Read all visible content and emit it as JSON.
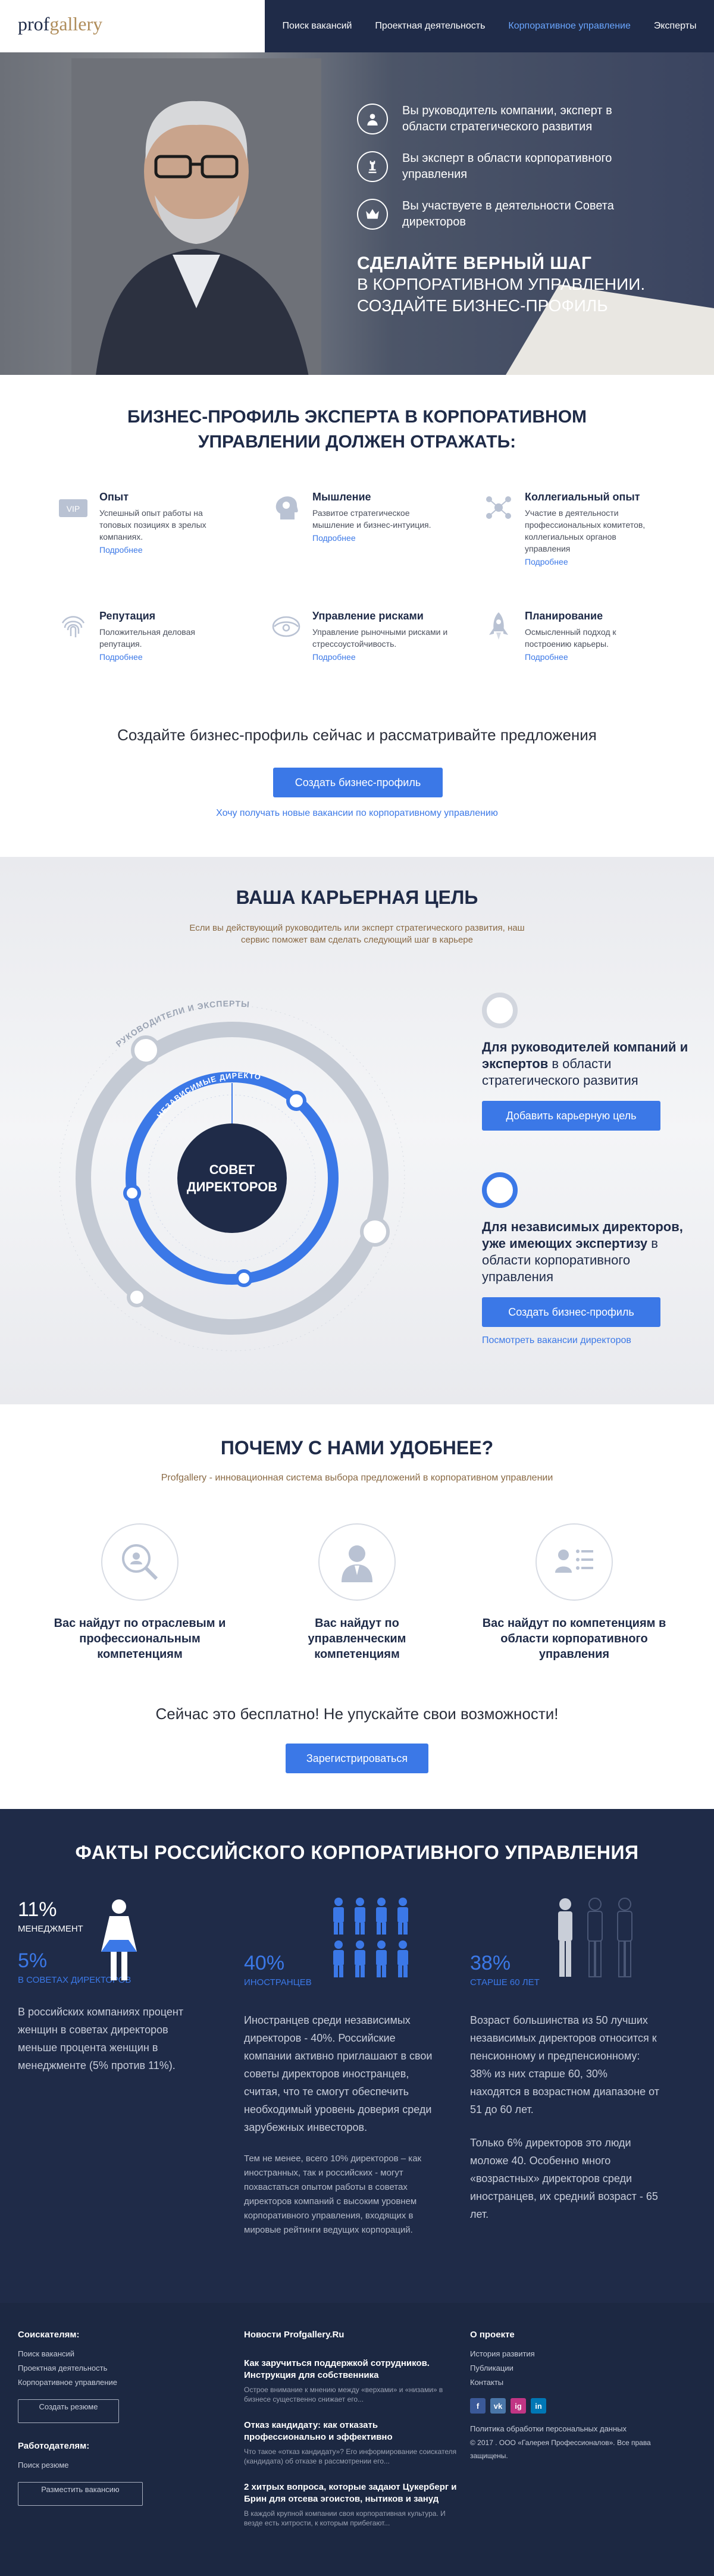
{
  "logo": {
    "a": "prof",
    "b": "gallery"
  },
  "nav": [
    "Поиск вакансий",
    "Проектная деятельность",
    "Корпоративное управление",
    "Эксперты"
  ],
  "hero": {
    "items": [
      {
        "icon": "person-icon",
        "text": "Вы руководитель компании, эксперт в области стратегического развития"
      },
      {
        "icon": "chess-icon",
        "text": "Вы эксперт в области корпоративного управления"
      },
      {
        "icon": "crown-icon",
        "text": "Вы участвуете в деятельности Совета директоров"
      }
    ],
    "t1": "СДЕЛАЙТЕ ВЕРНЫЙ ШАГ",
    "t2": "В КОРПОРАТИВНОМ УПРАВЛЕНИИ.",
    "t3": "СОЗДАЙТЕ БИЗНЕС-ПРОФИЛЬ"
  },
  "profile": {
    "title": "БИЗНЕС-ПРОФИЛЬ ЭКСПЕРТА В КОРПОРАТИВНОМ УПРАВЛЕНИИ ДОЛЖЕН ОТРАЖАТЬ:",
    "features": [
      {
        "icon": "vip-icon",
        "title": "Опыт",
        "desc": "Успешный опыт работы на топовых позициях в зрелых компаниях.",
        "link": "Подробнее"
      },
      {
        "icon": "brain-icon",
        "title": "Мышление",
        "desc": "Развитое стратегическое мышление и бизнес-интуиция.",
        "link": "Подробнее"
      },
      {
        "icon": "network-icon",
        "title": "Коллегиальный опыт",
        "desc": "Участие в деятельности профессиональных комитетов, коллегиальных органов управления",
        "link": "Подробнее"
      },
      {
        "icon": "fingerprint-icon",
        "title": "Репутация",
        "desc": "Положительная деловая репутация.",
        "link": "Подробнее"
      },
      {
        "icon": "risk-icon",
        "title": "Управление рисками",
        "desc": "Управление рыночными рисками и стрессоустойчивость.",
        "link": "Подробнее"
      },
      {
        "icon": "rocket-icon",
        "title": "Планирование",
        "desc": "Осмысленный подход к построению карьеры.",
        "link": "Подробнее"
      }
    ],
    "cta_text": "Создайте бизнес-профиль сейчас и рассматривайте предложения",
    "button": "Создать бизнес-профиль",
    "sub_link": "Хочу получать новые вакансии по корпоративному управлению"
  },
  "career": {
    "title": "ВАША КАРЬЕРНАЯ ЦЕЛЬ",
    "lead": "Если вы действующий руководитель или эксперт стратегического развития, наш сервис поможет вам сделать следующий шаг в карьере",
    "outer_label": "РУКОВОДИТЕЛИ И ЭКСПЕРТЫ",
    "inner_label": "НЕЗАВИСИМЫЕ ДИРЕКТОРА",
    "center_1": "СОВЕТ",
    "center_2": "ДИРЕКТОРОВ",
    "goal1": {
      "bold": "Для руководителей компаний и экспертов",
      "rest": " в области стратегического развития",
      "button": "Добавить карьерную цель"
    },
    "goal2": {
      "bold": "Для независимых директоров, уже имеющих экспертизу",
      "rest": " в области корпоративного управления",
      "button": "Создать бизнес-профиль",
      "link": "Посмотреть вакансии директоров"
    }
  },
  "why": {
    "title": "ПОЧЕМУ С НАМИ УДОБНЕЕ?",
    "lead": "Profgallery - инновационная система выбора предложений в корпоративном управлении",
    "items": [
      {
        "icon": "industry-search-icon",
        "text": "Вас найдут по отраслевым и профессиональным компетенциям"
      },
      {
        "icon": "manager-icon",
        "text": "Вас найдут по управленческим компетенциям"
      },
      {
        "icon": "governance-icon",
        "text": "Вас найдут по компетенциям в области корпоративного управления"
      }
    ],
    "cta_text": "Сейчас это бесплатно! Не упускайте свои возможности!",
    "button": "Зарегистрироваться"
  },
  "facts": {
    "title": "ФАКТЫ РОССИЙСКОГО КОРПОРАТИВНОГО УПРАВЛЕНИЯ",
    "items": [
      {
        "pct": "11%",
        "cap": "МЕНЕДЖМЕНТ",
        "pct2": "5%",
        "cap2": "В СОВЕТАХ ДИРЕКТОРОВ",
        "text": "В российских компаниях процент женщин в советах директоров меньше процента женщин в менеджменте (5% против 11%).",
        "text2": ""
      },
      {
        "pct": "40%",
        "cap": "ИНОСТРАНЦЕВ",
        "text": "Иностранцев среди независимых директоров - 40%. Российские компании активно приглашают в свои советы директоров иностранцев, считая, что те смогут обеспечить необходимый уровень доверия среди зарубежных инвесторов.",
        "text2": "Тем не менее, всего 10% директоров – как иностранных, так и российских - могут похвастаться опытом работы в советах директоров компаний с высоким уровнем корпоративного управления, входящих в мировые рейтинги ведущих корпораций."
      },
      {
        "pct": "38%",
        "cap": "СТАРШЕ 60 ЛЕТ",
        "text": "Возраст большинства из 50 лучших независимых директоров относится к пенсионному и предпенсионному: 38% из них старше 60, 30% находятся в возрастном диапазоне от 51 до 60 лет.",
        "text2": "Только 6% директоров это люди моложе 40. Особенно много «возрастных» директоров среди иностранцев, их средний возраст - 65 лет."
      }
    ]
  },
  "footer": {
    "seekers": {
      "title": "Соискателям:",
      "links": [
        "Поиск вакансий",
        "Проектная деятельность",
        "Корпоративное управление"
      ],
      "button": "Создать резюме"
    },
    "employers": {
      "title": "Работодателям:",
      "links": [
        "Поиск резюме"
      ],
      "button": "Разместить вакансию"
    },
    "news": {
      "title": "Новости Profgallery.Ru",
      "items": [
        {
          "title": "Как заручиться поддержкой сотрудников. Инструкция для собственника",
          "desc": "Острое внимание к мнению между «верхами» и «низами» в бизнесе существенно снижает его..."
        },
        {
          "title": "Отказ кандидату: как отказать профессионально и эффективно",
          "desc": "Что такое «отказ кандидату»? Его информирование соискателя (кандидата) об отказе в рассмотрении его..."
        },
        {
          "title": "2 хитрых вопроса, которые задают Цукерберг и Брин для отсева эгоистов, нытиков и зануд",
          "desc": "В каждой крупной компании своя корпоративная культура. И везде есть хитрости, к которым прибегают..."
        }
      ]
    },
    "about": {
      "title": "О проекте",
      "links": [
        "История развития",
        "Публикации",
        "Контакты"
      ],
      "policy": "Политика обработки персональных данных",
      "copy": "© 2017 . ООО «Галерея Профессионалов». Все права защищены."
    },
    "social": [
      "f",
      "vk",
      "ig",
      "in"
    ]
  }
}
